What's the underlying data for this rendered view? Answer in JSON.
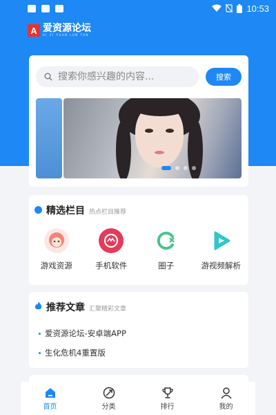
{
  "status_bar": {
    "time": "10:53"
  },
  "brand": {
    "name": "爱资源论坛",
    "sub": "AI ZI YUAN LUN TAN"
  },
  "search": {
    "placeholder": "搜索你感兴趣的内容...",
    "button": "搜索"
  },
  "banner": {
    "dots": 4,
    "active_dot": 0
  },
  "featured": {
    "title": "精选栏目",
    "subtitle": "热点栏目推荐",
    "items": [
      {
        "label": "游戏资源",
        "icon": "anime-avatar-icon",
        "color": "#f0857a"
      },
      {
        "label": "手机软件",
        "icon": "app-grid-icon",
        "color": "#e53a5a"
      },
      {
        "label": "圈子",
        "icon": "circle-c-icon",
        "color": "#4cc38a"
      },
      {
        "label": "游视频解析",
        "icon": "video-play-icon",
        "color": "#2fc7c9"
      }
    ]
  },
  "articles": {
    "title": "推荐文章",
    "subtitle": "汇聚精彩文章",
    "items": [
      "爱资源论坛-安卓端APP",
      "生化危机4重置版"
    ]
  },
  "tabs": [
    {
      "label": "首页",
      "icon": "home-icon",
      "active": true
    },
    {
      "label": "分类",
      "icon": "category-icon",
      "active": false
    },
    {
      "label": "排行",
      "icon": "trophy-icon",
      "active": false
    },
    {
      "label": "我的",
      "icon": "user-icon",
      "active": false
    }
  ],
  "colors": {
    "primary": "#1e88f5",
    "background": "#f3f4f7"
  }
}
